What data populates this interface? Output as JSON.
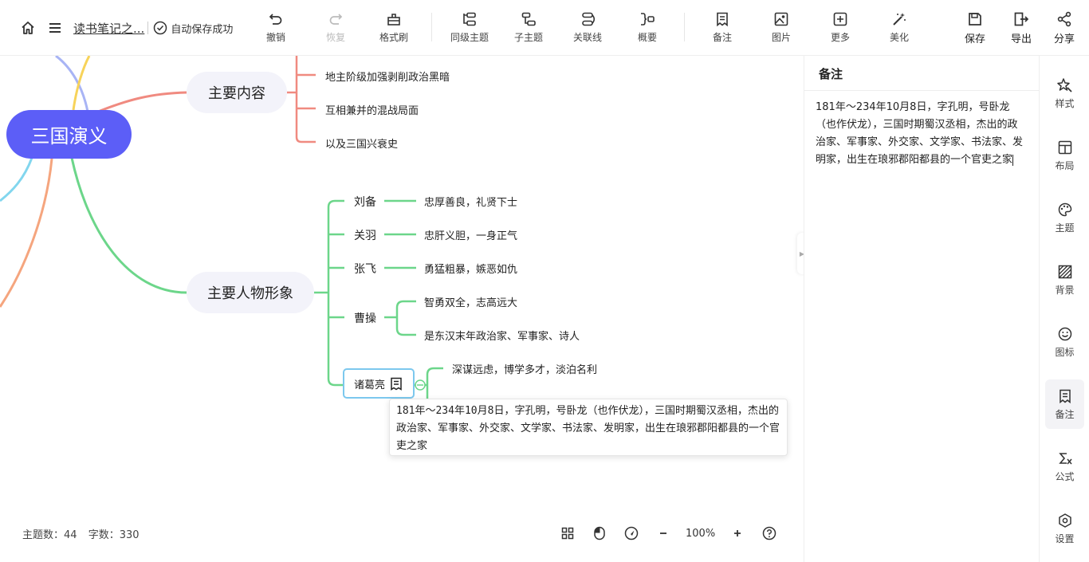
{
  "header": {
    "doc_title": "读书笔记之...",
    "save_status": "自动保存成功",
    "tools": {
      "undo": "撤销",
      "redo": "恢复",
      "format_brush": "格式刷",
      "sibling_topic": "同级主题",
      "child_topic": "子主题",
      "relation_line": "关联线",
      "summary": "概要",
      "note": "备注",
      "image": "图片",
      "more": "更多",
      "beautify": "美化",
      "save": "保存",
      "export": "导出",
      "share": "分享"
    }
  },
  "mindmap": {
    "root": "三国演义",
    "main_content": {
      "label": "主要内容",
      "items": [
        "地主阶级加强剥削政治黑暗",
        "互相兼并的混战局面",
        "以及三国兴衰史"
      ]
    },
    "characters": {
      "label": "主要人物形象",
      "liubei": {
        "name": "刘备",
        "trait": "忠厚善良，礼贤下士"
      },
      "guanyu": {
        "name": "关羽",
        "trait": "忠肝义胆，一身正气"
      },
      "zhangfei": {
        "name": "张飞",
        "trait": "勇猛粗暴，嫉恶如仇"
      },
      "caocao": {
        "name": "曹操",
        "traits": [
          "智勇双全，志高远大",
          "是东汉末年政治家、军事家、诗人"
        ]
      },
      "zhuge": {
        "name": "诸葛亮",
        "trait": "深谋远虑，博学多才，淡泊名利"
      }
    },
    "tooltip": "181年～234年10月8日，字孔明，号卧龙（也作伏龙），三国时期蜀汉丞相，杰出的政治家、军事家、外交家、文学家、书法家、发明家，出生在琅邪郡阳都县的一个官吏之家"
  },
  "status": {
    "topics": "主题数：44",
    "words": "字数：330",
    "zoom": "100%"
  },
  "notes": {
    "title": "备注",
    "content": "181年～234年10月8日，字孔明，号卧龙（也作伏龙），三国时期蜀汉丞相，杰出的政治家、军事家、外交家、文学家、书法家、发明家，出生在琅邪郡阳都县的一个官吏之家"
  },
  "sidebar": {
    "style": "样式",
    "layout": "布局",
    "theme": "主题",
    "background": "背景",
    "icon": "图标",
    "note": "备注",
    "formula": "公式",
    "settings": "设置"
  }
}
